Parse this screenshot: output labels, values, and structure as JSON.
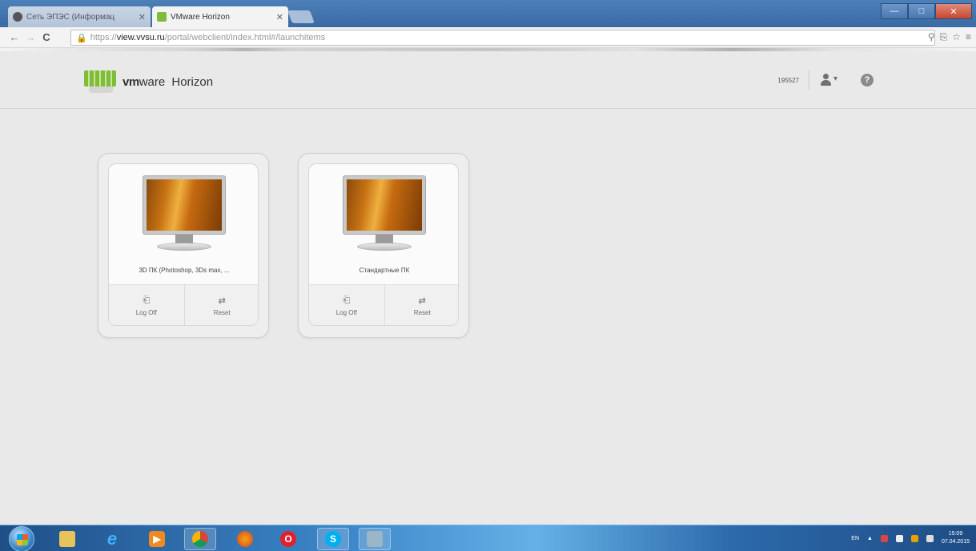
{
  "browser": {
    "tabs": [
      {
        "label": "Сеть ЭПЭС (Информац",
        "active": false
      },
      {
        "label": "VMware Horizon",
        "active": true
      }
    ],
    "url": {
      "scheme": "https://",
      "host": "view.vvsu.ru",
      "path": "/portal/webclient/index.html#/launchitems"
    },
    "window_controls": {
      "minimize": "—",
      "maximize": "□",
      "close": "✕"
    }
  },
  "header": {
    "brand_bold": "vm",
    "brand_rest": "ware",
    "product": "Horizon",
    "username": "195527"
  },
  "desktops": [
    {
      "name": "3D ПК (Photoshop, 3Ds max, ...",
      "actions": [
        {
          "label": "Log Off",
          "icon": "logoff-icon"
        },
        {
          "label": "Reset",
          "icon": "reset-icon"
        }
      ]
    },
    {
      "name": "Стандартные ПК",
      "actions": [
        {
          "label": "Log Off",
          "icon": "logoff-icon"
        },
        {
          "label": "Reset",
          "icon": "reset-icon"
        }
      ]
    }
  ],
  "taskbar": {
    "apps": [
      "windows-explorer",
      "internet-explorer",
      "media-player",
      "chrome",
      "firefox",
      "opera",
      "skype",
      "vmware-horizon"
    ],
    "tray": {
      "lang": "EN",
      "time": "15:09",
      "date": "07.04.2015"
    }
  },
  "colors": {
    "accent_green": "#7fbc38",
    "background": "#e9e9e9",
    "taskbar_blue": "#3c86c9"
  }
}
